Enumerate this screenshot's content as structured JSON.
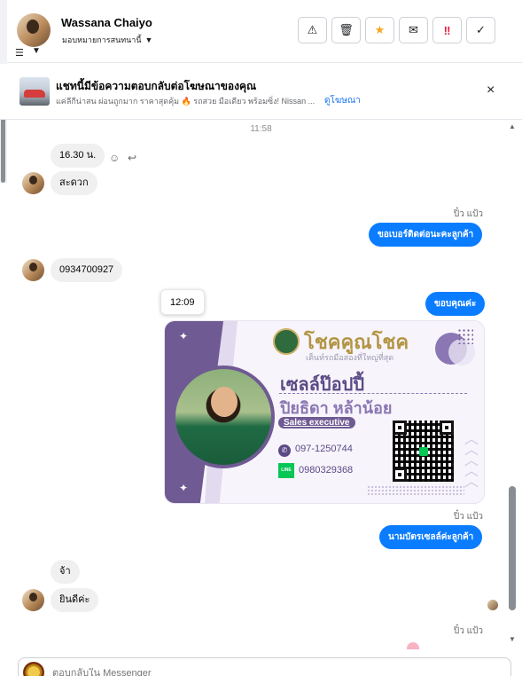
{
  "header": {
    "contact_name": "Wassana Chaiyo",
    "assign_label": "มอบหมายการสนทนานี้",
    "actions": [
      {
        "name": "spam-button",
        "icon": "warning-icon",
        "glyph": "⚠"
      },
      {
        "name": "delete-button",
        "icon": "trash-icon",
        "glyph": "🗑"
      },
      {
        "name": "star-button",
        "icon": "star-icon",
        "glyph": "★"
      },
      {
        "name": "mark-unread-button",
        "icon": "envelope-icon",
        "glyph": "✉"
      },
      {
        "name": "follow-up-button",
        "icon": "urgent-icon",
        "glyph": "‼"
      },
      {
        "name": "done-button",
        "icon": "check-icon",
        "glyph": "✓"
      }
    ]
  },
  "ad": {
    "title": "แชทนี้มีข้อความตอบกลับต่อโฆษณาของคุณ",
    "description": "แค่ลีกีน่าสน ผ่อนถูกมาก ราคาสุดคุ้ม 🔥 รถสวย มือเดียว พร้อมซิ่ง! Nissan ...",
    "link": "ดูโฆษณา",
    "close": "×"
  },
  "chat": {
    "timestamp": "11:58",
    "messages": [
      {
        "id": "m1",
        "dir": "in",
        "text": "16.30 น."
      },
      {
        "id": "m2",
        "dir": "in",
        "text": "สะดวก"
      },
      {
        "id": "m3",
        "dir": "out",
        "sender": "ปิ๋ว แป้ว",
        "text": "ขอเบอร์ติดต่อนะคะลูกค้า"
      },
      {
        "id": "m4",
        "dir": "in",
        "text": "0934700927"
      },
      {
        "id": "m5",
        "dir": "out",
        "text": "ขอบคุณค่ะ",
        "tooltip": "12:09"
      },
      {
        "id": "m6",
        "dir": "out",
        "sender": "ปิ๋ว แป้ว",
        "text": "นามบัตรเซลล์ค่ะลูกค้า"
      },
      {
        "id": "m7",
        "dir": "in",
        "text": "จ้า"
      },
      {
        "id": "m8",
        "dir": "in",
        "text": "ยินดีค่ะ"
      },
      {
        "id": "m9",
        "dir": "out",
        "sender": "ปิ๋ว แป้ว"
      }
    ],
    "card": {
      "brand": "โชคคูณโชค",
      "brand_sub": "เต็นท์รถมือสองที่ใหญ่ที่สุด",
      "nickname": "เซลล์ป๊อปปี้",
      "fullname": "ปิยธิดา หล้าน้อย",
      "position": "Sales executive",
      "phone": "097-1250744",
      "line_label": "LINE",
      "line_id": "0980329368",
      "accent": "#6f5a93"
    }
  },
  "composer": {
    "placeholder": "ตอบกลับใน Messenger"
  },
  "colors": {
    "outgoing_bubble": "#0a7cff",
    "incoming_bubble": "#f0f0f0",
    "link": "#1877f2"
  }
}
